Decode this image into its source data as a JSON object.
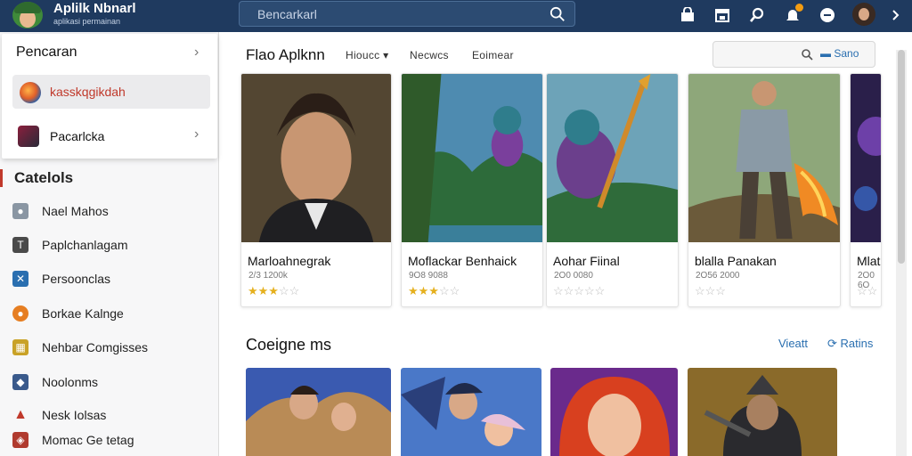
{
  "brand": {
    "title": "Aplilk Nbnarl",
    "subtitle": "aplikasi permainan"
  },
  "search": {
    "placeholder": "Bencarkarl"
  },
  "topbar_icons": [
    "store-icon",
    "calendar-icon",
    "search-icon",
    "notification-icon",
    "account-circle-icon",
    "avatar",
    "chevron-right-icon"
  ],
  "dropdown_menu": {
    "header": "Pencaran",
    "items": [
      {
        "label": "kasskqgikdah",
        "active": true
      },
      {
        "label": "Pacarlcka",
        "active": false
      }
    ]
  },
  "categories": {
    "title": "Catelols",
    "items": [
      {
        "label": "Nael Mahos",
        "icon": "user-icon",
        "color": "#5d6d7e"
      },
      {
        "label": "Paplchanlagam",
        "icon": "t-icon",
        "color": "#4a4a4a"
      },
      {
        "label": "Persoonclas",
        "icon": "x-icon",
        "color": "#2a6fb0"
      },
      {
        "label": "Borkae Kalnge",
        "icon": "circle-icon",
        "color": "#e67e22"
      },
      {
        "label": "Nehbar Comgisses",
        "icon": "grid-icon",
        "color": "#c9a227"
      },
      {
        "label": "Noolonms",
        "icon": "puzzle-icon",
        "color": "#3a5a8c"
      },
      {
        "label": "Nesk Iolsas",
        "icon": "arrow-up-icon",
        "color": "#c0392b"
      },
      {
        "label": "Momac Ge tetag",
        "icon": "tag-icon",
        "color": "#b03a2e"
      }
    ]
  },
  "featured": {
    "title": "Flao Aplknn",
    "filters": [
      "Hioucc",
      "Necwcs",
      "Eoimear"
    ],
    "search_button": "Sano",
    "apps": [
      {
        "title": "Marloahnegrak",
        "meta": "2/3 1200k",
        "rating": 3
      },
      {
        "title": "Moflackar Benhaick",
        "meta": "9O8 9088",
        "rating": 3
      },
      {
        "title": "Aohar Fiinal",
        "meta": "2O0 0080",
        "rating": 0
      },
      {
        "title": "blalla Panakan",
        "meta": "2O56 2000",
        "rating": 0
      },
      {
        "title": "Mlat",
        "meta": "2O0 6O",
        "rating": 0
      }
    ]
  },
  "second_section": {
    "title": "Coeigne ms",
    "link_view": "Vieatt",
    "link_more": "Ratins"
  }
}
